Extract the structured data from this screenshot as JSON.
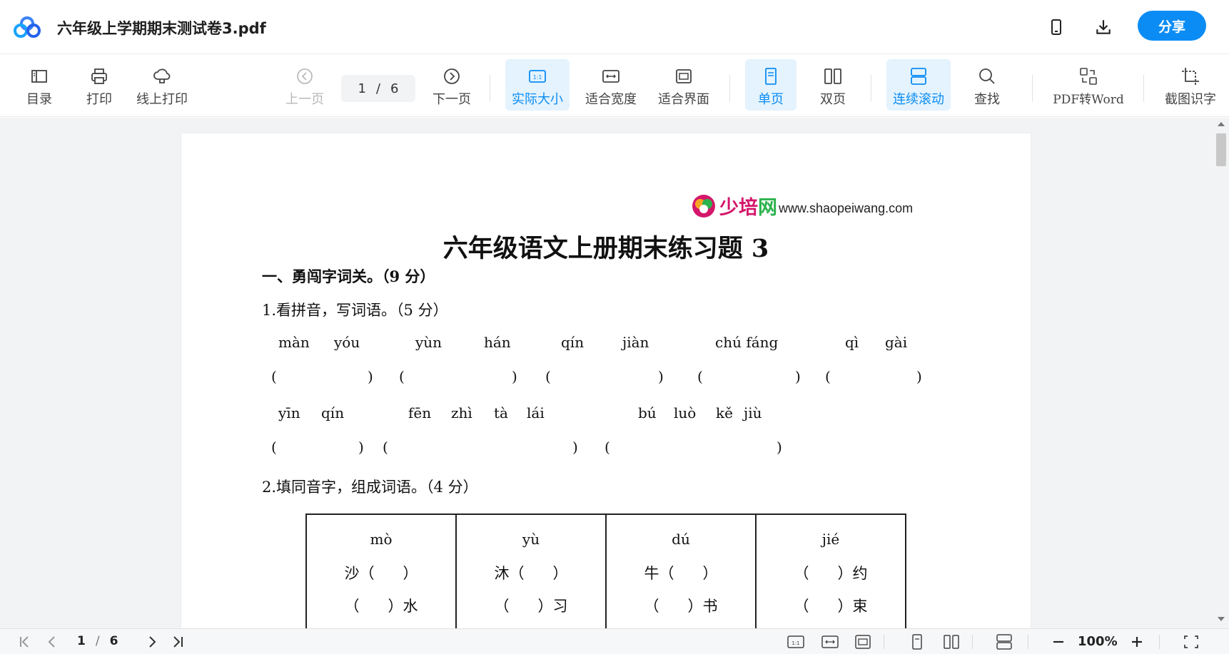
{
  "window": {
    "title": "六年级上学期期末测试卷3.pdf",
    "share_label": "分享",
    "accent": "#0b8cf5",
    "icons": [
      "phone-icon",
      "download-icon"
    ]
  },
  "toolbar": {
    "catalog": "目录",
    "print": "打印",
    "online_print": "线上打印",
    "prev_page": "上一页",
    "page_current": "1",
    "page_sep": "/",
    "page_total": "6",
    "next_page": "下一页",
    "actual_size": "实际大小",
    "fit_width": "适合宽度",
    "fit_screen": "适合界面",
    "single_page": "单页",
    "double_page": "双页",
    "continuous_scroll": "连续滚动",
    "find": "查找",
    "pdf_to_word": "PDF转Word",
    "ocr": "截图识字",
    "active_tools": [
      "实际大小",
      "单页",
      "连续滚动"
    ]
  },
  "document": {
    "watermark_url": "www.shaopeiwang.com",
    "title": "六年级语文上册期末练习题 3",
    "section1": "一、勇闯字词关。（9 分）",
    "q1": "1.看拼音，写词语。（5 分）",
    "pinyin_row1": [
      "màn",
      "yóu",
      "yùn",
      "hán",
      "qín",
      "jiàn",
      "chú fáng",
      "qì",
      "gài"
    ],
    "pinyin_row2": [
      "yīn",
      "qín",
      "fēn",
      "zhì",
      "tà",
      "lái",
      "bú",
      "luò",
      "kě",
      "jiù"
    ],
    "q2": "2.填同音字，组成词语。（4 分）",
    "table": [
      {
        "pinyin": "mò",
        "row1": "沙（      ）",
        "row2": "（      ）水"
      },
      {
        "pinyin": "yù",
        "row1": "沐（      ）",
        "row2": "（      ）习"
      },
      {
        "pinyin": "dú",
        "row1": "牛（      ）",
        "row2": "（      ）书"
      },
      {
        "pinyin": "jié",
        "row1": "（      ）约",
        "row2": "（      ）束"
      }
    ]
  },
  "bottombar": {
    "page_current": "1",
    "page_sep": "/",
    "page_total": "6",
    "zoom": "100%"
  }
}
